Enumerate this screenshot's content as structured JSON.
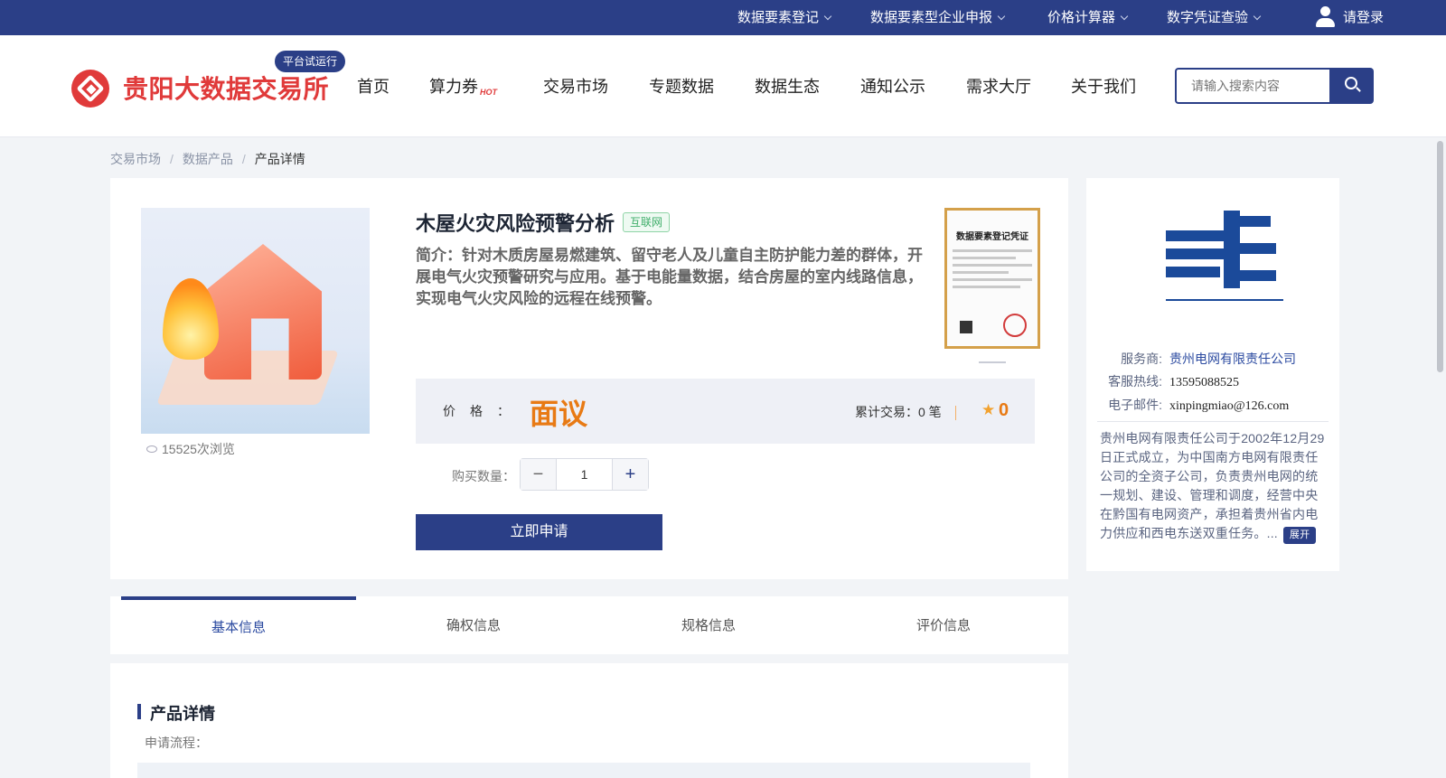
{
  "topbar": {
    "items": [
      {
        "label": "数据要素登记"
      },
      {
        "label": "数据要素型企业申报"
      },
      {
        "label": "价格计算器"
      },
      {
        "label": "数字凭证查验"
      }
    ],
    "login_label": "请登录"
  },
  "header": {
    "logo_text": "贵阳大数据交易所",
    "beta_badge": "平台试运行",
    "nav": [
      {
        "label": "首页"
      },
      {
        "label": "算力券",
        "hot": "HOT"
      },
      {
        "label": "交易市场"
      },
      {
        "label": "专题数据"
      },
      {
        "label": "数据生态"
      },
      {
        "label": "通知公示"
      },
      {
        "label": "需求大厅"
      },
      {
        "label": "关于我们"
      }
    ],
    "search_placeholder": "请输入搜索内容"
  },
  "breadcrumb": {
    "items": [
      "交易市场",
      "数据产品",
      "产品详情"
    ],
    "separator": "/"
  },
  "product": {
    "title": "木屋火灾风险预警分析",
    "tag": "互联网",
    "intro": "简介：针对木质房屋易燃建筑、留守老人及儿童自主防护能力差的群体，开展电气火灾预警研究与应用。基于电能量数据，结合房屋的室内线路信息，实现电气火灾风险的远程在线预警。",
    "views": "15525次浏览",
    "cert_title": "数据要素登记凭证",
    "price_label": "价格：",
    "price_value": "面议",
    "trade_count": "累计交易：0 笔",
    "rating": "0",
    "qty_label": "购买数量：",
    "qty_value": "1",
    "apply_label": "立即申请"
  },
  "provider": {
    "rows": [
      {
        "key": "服务商:",
        "value": "贵州电网有限责任公司"
      },
      {
        "key": "客服热线:",
        "value": "13595088525"
      },
      {
        "key": "电子邮件:",
        "value": "xinpingmiao@126.com"
      }
    ],
    "description": "贵州电网有限责任公司于2002年12月29日正式成立，为中国南方电网有限责任公司的全资子公司，负责贵州电网的统一规划、建设、管理和调度，经营中央在黔国有电网资产，承担着贵州省内电力供应和西电东送双重任务。...",
    "expand_label": "展开",
    "brand_color": "#1b4a9a"
  },
  "tabs": [
    {
      "label": "基本信息"
    },
    {
      "label": "确权信息"
    },
    {
      "label": "规格信息"
    },
    {
      "label": "评价信息"
    }
  ],
  "detail": {
    "heading": "产品详情",
    "sub_label": "申请流程："
  },
  "colors": {
    "primary": "#2b3f87",
    "price": "#e87a14",
    "logo_red": "#e03a3a"
  }
}
